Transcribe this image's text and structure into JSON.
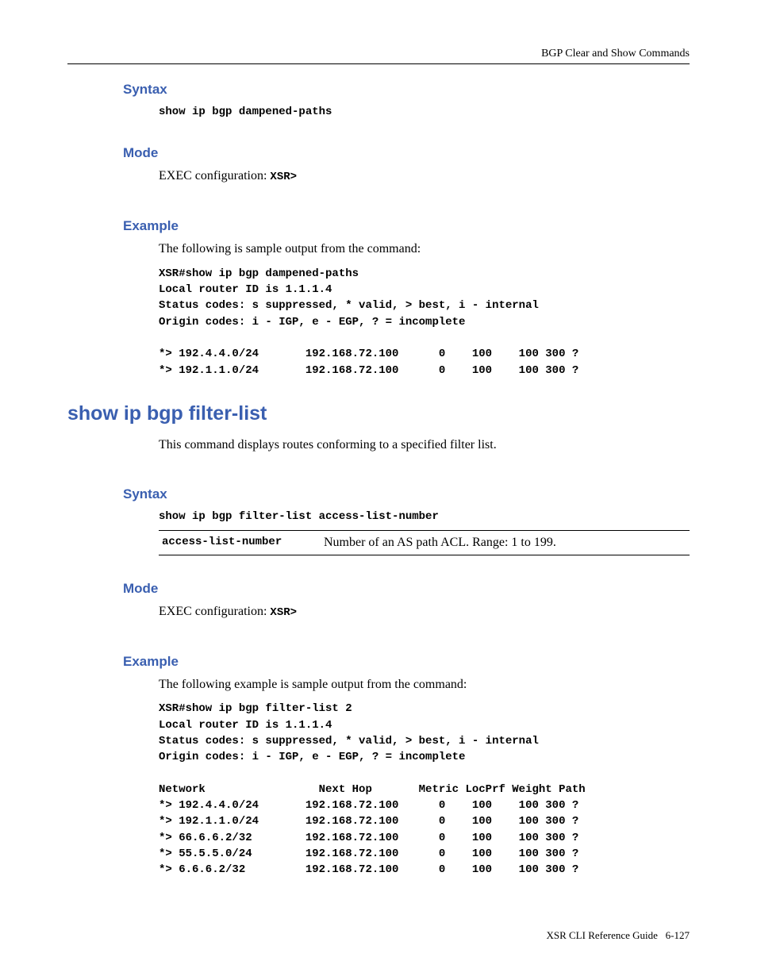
{
  "header": {
    "right": "BGP Clear and Show Commands"
  },
  "sec1": {
    "syntax_label": "Syntax",
    "syntax_cmd": "show ip bgp dampened-paths",
    "mode_label": "Mode",
    "mode_text_prefix": "EXEC configuration: ",
    "mode_prompt": "XSR>",
    "example_label": "Example",
    "example_intro": "The following is sample output from the command:",
    "example_output": "XSR#show ip bgp dampened-paths\nLocal router ID is 1.1.1.4\nStatus codes: s suppressed, * valid, > best, i - internal\nOrigin codes: i - IGP, e - EGP, ? = incomplete\n\n*> 192.4.4.0/24       192.168.72.100      0    100    100 300 ?\n*> 192.1.1.0/24       192.168.72.100      0    100    100 300 ?"
  },
  "cmd2": {
    "title": "show ip bgp filter-list",
    "description": "This command displays routes conforming to a specified filter list.",
    "syntax_label": "Syntax",
    "syntax_cmd": "show ip bgp filter-list access-list-number",
    "param_name": "access-list-number",
    "param_desc": "Number of an AS path ACL. Range: 1 to 199.",
    "mode_label": "Mode",
    "mode_text_prefix": "EXEC configuration: ",
    "mode_prompt": "XSR>",
    "example_label": "Example",
    "example_intro": "The following example is sample output from the command:",
    "example_output": "XSR#show ip bgp filter-list 2\nLocal router ID is 1.1.1.4\nStatus codes: s suppressed, * valid, > best, i - internal\nOrigin codes: i - IGP, e - EGP, ? = incomplete\n\nNetwork                 Next Hop       Metric LocPrf Weight Path\n*> 192.4.4.0/24       192.168.72.100      0    100    100 300 ?\n*> 192.1.1.0/24       192.168.72.100      0    100    100 300 ?\n*> 66.6.6.2/32        192.168.72.100      0    100    100 300 ?\n*> 55.5.5.0/24        192.168.72.100      0    100    100 300 ?\n*> 6.6.6.2/32         192.168.72.100      0    100    100 300 ?"
  },
  "footer": {
    "left": "XSR CLI Reference Guide",
    "right": "6-127"
  }
}
